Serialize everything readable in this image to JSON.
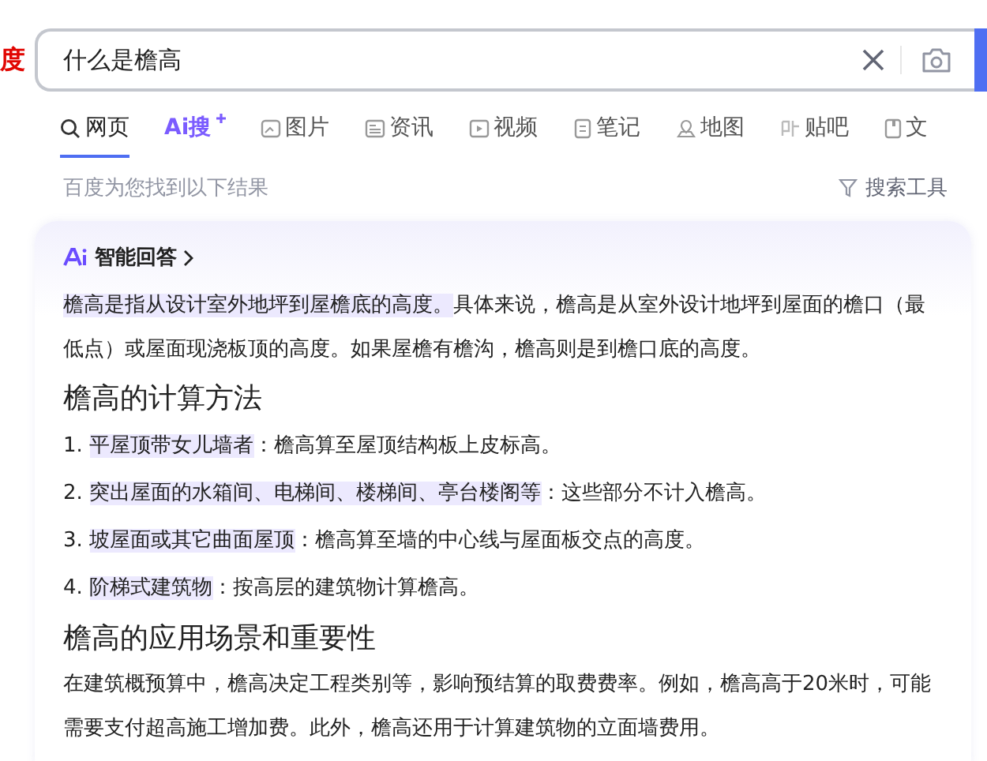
{
  "logo": {
    "text": "度"
  },
  "search": {
    "value": "什么是檐高"
  },
  "tabs": [
    {
      "label": "网页",
      "kind": "search",
      "selected": true
    },
    {
      "label": "Ai搜",
      "kind": "ai",
      "selected": false
    },
    {
      "label": "图片",
      "kind": "image",
      "selected": false
    },
    {
      "label": "资讯",
      "kind": "news",
      "selected": false
    },
    {
      "label": "视频",
      "kind": "video",
      "selected": false
    },
    {
      "label": "笔记",
      "kind": "note",
      "selected": false
    },
    {
      "label": "地图",
      "kind": "map",
      "selected": false
    },
    {
      "label": "贴吧",
      "kind": "tieba",
      "selected": false
    },
    {
      "label": "文",
      "kind": "doc",
      "selected": false
    }
  ],
  "result_count": "百度为您找到以下结果",
  "search_tools": "搜索工具",
  "ai_answer": {
    "title": "智能回答",
    "intro": {
      "highlight": "檐高是指从设计室外地坪到屋檐底的高度。",
      "text": "具体来说，檐高是从室外设计地坪到屋面的檐口（最低点）或屋面现浇板顶的高度。如果屋檐有檐沟，檐高则是到檐口底的高度。"
    },
    "sections": [
      {
        "heading": "檐高的计算方法",
        "items": [
          {
            "number": "1.",
            "highlight": "平屋顶带女儿墙者",
            "text": "：檐高算至屋顶结构板上皮标高。"
          },
          {
            "number": "2.",
            "highlight": "突出屋面的水箱间、电梯间、楼梯间、亭台楼阁等",
            "text": "：这些部分不计入檐高。"
          },
          {
            "number": "3.",
            "highlight": "坡屋面或其它曲面屋顶",
            "text": "：檐高算至墙的中心线与屋面板交点的高度。"
          },
          {
            "number": "4.",
            "highlight": "阶梯式建筑物",
            "text": "：按高层的建筑物计算檐高。"
          }
        ]
      },
      {
        "heading": "檐高的应用场景和重要性",
        "paragraph": "在建筑概预算中，檐高决定工程类别等，影响预结算的取费费率。例如，檐高高于20米时，可能需要支付超高施工增加费。此外，檐高还用于计算建筑物的立面墙费用。"
      }
    ]
  }
}
